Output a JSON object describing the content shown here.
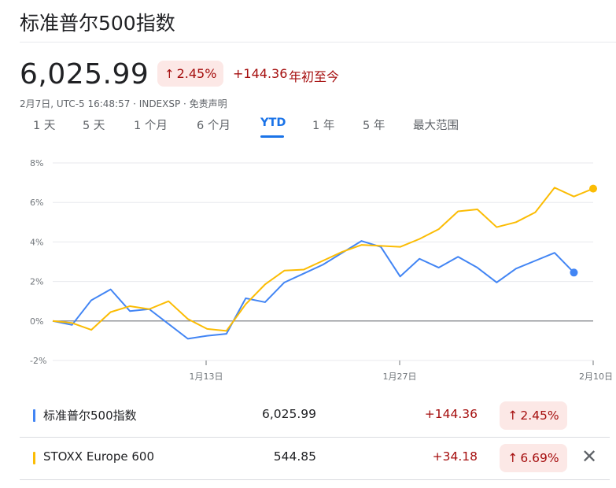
{
  "header": {
    "title": "标准普尔500指数"
  },
  "quote": {
    "price": "6,025.99",
    "change_pct": "2.45%",
    "change_abs": "+144.36",
    "period": "年初至今",
    "meta": "2月7日, UTC-5 16:48:57 · INDEXSP · 免责声明"
  },
  "icons": {
    "up_arrow": "↑",
    "close": "✕"
  },
  "tabs": [
    {
      "label": "1 天"
    },
    {
      "label": "5 天"
    },
    {
      "label": "1 个月"
    },
    {
      "label": "6 个月"
    },
    {
      "label": "YTD",
      "active": true
    },
    {
      "label": "1 年"
    },
    {
      "label": "5 年"
    },
    {
      "label": "最大范围"
    }
  ],
  "colors": {
    "spx": "#4285f4",
    "stoxx": "#fbbc04",
    "negative_bg": "#fce8e6",
    "negative_text": "#a50e0e",
    "accent": "#1a73e8"
  },
  "chart_data": {
    "type": "line",
    "x_labels": [
      "1月13日",
      "1月27日",
      "2月10日"
    ],
    "y_ticks": [
      "8%",
      "6%",
      "4%",
      "2%",
      "0%",
      "-2%"
    ],
    "ylim": [
      -2,
      8
    ],
    "baseline": 0,
    "legend": "bottom",
    "series": [
      {
        "name": "标准普尔500指数",
        "color": "#4285f4",
        "values": [
          0.0,
          -0.2,
          1.05,
          1.6,
          0.5,
          0.6,
          -0.15,
          -0.9,
          -0.75,
          -0.65,
          1.15,
          0.95,
          1.95,
          2.4,
          2.85,
          3.45,
          4.05,
          3.75,
          2.25,
          3.15,
          2.7,
          3.25,
          2.7,
          1.95,
          2.65,
          3.05,
          3.45,
          2.45
        ]
      },
      {
        "name": "STOXX Europe 600",
        "color": "#fbbc04",
        "values": [
          0.0,
          -0.1,
          -0.45,
          0.45,
          0.75,
          0.6,
          1.0,
          0.1,
          -0.4,
          -0.5,
          0.85,
          1.85,
          2.55,
          2.6,
          3.05,
          3.5,
          3.85,
          3.8,
          3.75,
          4.15,
          4.65,
          5.55,
          5.65,
          4.75,
          5.0,
          5.5,
          6.75,
          6.3,
          6.7
        ]
      }
    ]
  },
  "comparison": [
    {
      "name": "标准普尔500指数",
      "value": "6,025.99",
      "change_abs": "+144.36",
      "change_pct": "2.45%",
      "color": "#4285f4"
    },
    {
      "name": "STOXX Europe 600",
      "value": "544.85",
      "change_abs": "+34.18",
      "change_pct": "6.69%",
      "color": "#fbbc04"
    }
  ]
}
